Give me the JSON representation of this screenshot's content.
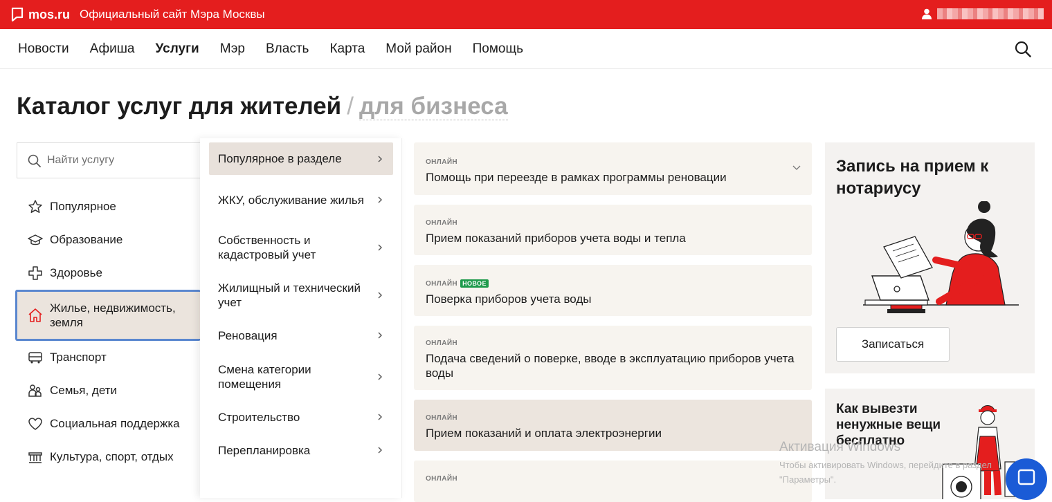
{
  "topbar": {
    "logo": "mos.ru",
    "site_title": "Официальный сайт Мэра Москвы",
    "user_icon": "user-icon"
  },
  "nav": {
    "items": [
      "Новости",
      "Афиша",
      "Услуги",
      "Мэр",
      "Власть",
      "Карта",
      "Мой район",
      "Помощь"
    ],
    "active": "Услуги",
    "search_icon": "search-icon"
  },
  "title": {
    "main": "Каталог услуг для жителей",
    "separator": "/",
    "alt": "для бизнеса"
  },
  "search": {
    "placeholder": "Найти услугу"
  },
  "categories": [
    {
      "label": "Популярное",
      "icon": "star-icon"
    },
    {
      "label": "Образование",
      "icon": "graduation-cap-icon"
    },
    {
      "label": "Здоровье",
      "icon": "medical-cross-icon"
    },
    {
      "label": "Жилье, недвижимость, земля",
      "icon": "house-icon",
      "active": true
    },
    {
      "label": "Транспорт",
      "icon": "bus-icon"
    },
    {
      "label": "Семья, дети",
      "icon": "family-icon"
    },
    {
      "label": "Социальная поддержка",
      "icon": "heart-icon"
    },
    {
      "label": "Культура, спорт, отдых",
      "icon": "museum-icon"
    }
  ],
  "subcategories": [
    {
      "label": "Популярное в разделе",
      "active": true
    },
    {
      "label": "ЖКУ, обслуживание жилья"
    },
    {
      "label": "Собственность и кадастровый учет"
    },
    {
      "label": "Жилищный и технический учет"
    },
    {
      "label": "Реновация"
    },
    {
      "label": "Смена категории помещения"
    },
    {
      "label": "Строительство"
    },
    {
      "label": "Перепланировка"
    }
  ],
  "services": [
    {
      "tag": "онлайн",
      "title": "Помощь при переезде в рамках программы реновации",
      "expandable": true
    },
    {
      "tag": "онлайн",
      "title": "Прием показаний приборов учета воды и тепла"
    },
    {
      "tag": "онлайн",
      "badge": "НОВОЕ",
      "title": "Поверка приборов учета воды"
    },
    {
      "tag": "онлайн",
      "title": "Подача сведений о поверке, вводе в эксплуатацию приборов учета воды"
    },
    {
      "tag": "онлайн",
      "title": "Прием показаний и оплата электроэнергии"
    },
    {
      "tag": "онлайн",
      "title": ""
    }
  ],
  "promo1": {
    "title": "Запись на прием к нотариусу",
    "button": "Записаться"
  },
  "promo2": {
    "title": "Как вывезти ненужные вещи бесплатно"
  },
  "watermark": {
    "line1": "Активация Windows",
    "line2": "Чтобы активировать Windows, перейдите в раздел \"Параметры\"."
  },
  "colors": {
    "brand_red": "#e41e1e",
    "active_bg": "#ebe4dd",
    "card_bg": "#f7f4ef",
    "badge_green": "#1e9a4b",
    "focus_blue": "#5a87cf"
  }
}
